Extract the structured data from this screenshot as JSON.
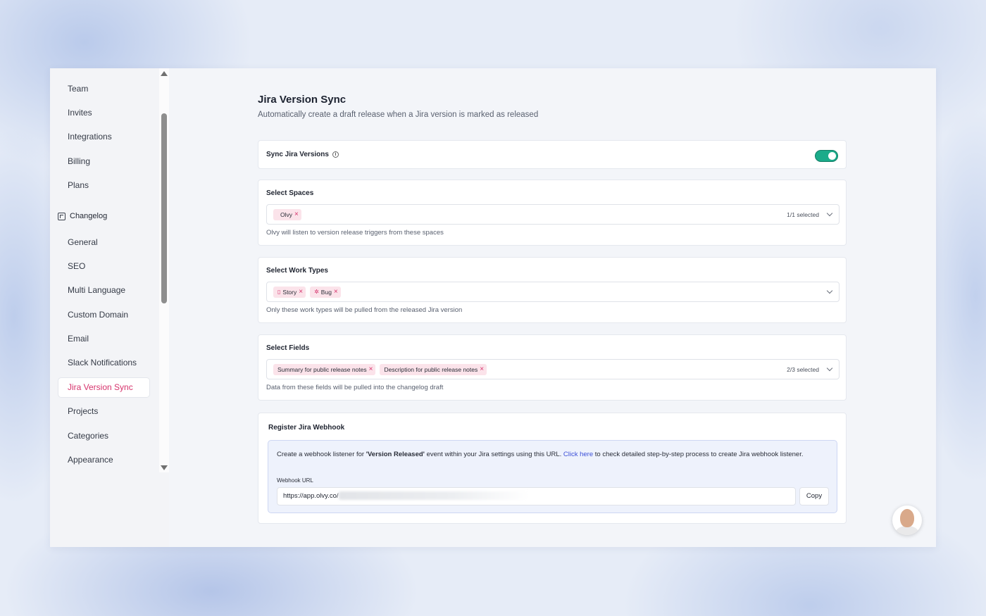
{
  "sidebar": {
    "items_top": [
      "Team",
      "Invites",
      "Integrations",
      "Billing",
      "Plans"
    ],
    "section_label": "Changelog",
    "items": [
      "General",
      "SEO",
      "Multi Language",
      "Custom Domain",
      "Email",
      "Slack Notifications",
      "Jira Version Sync",
      "Projects",
      "Categories",
      "Appearance"
    ],
    "active_item": "Jira Version Sync"
  },
  "page": {
    "title": "Jira Version Sync",
    "subtitle": "Automatically create a draft release when a Jira version is marked as released"
  },
  "sync": {
    "label": "Sync Jira Versions",
    "info_icon": "info-icon",
    "enabled": true,
    "toggle_color": "#1bab8a"
  },
  "spaces": {
    "label": "Select Spaces",
    "chips": [
      "Olvy"
    ],
    "count": "1/1 selected",
    "help": "Olvy will listen to version release triggers from these spaces"
  },
  "work_types": {
    "label": "Select Work Types",
    "chips": [
      {
        "label": "Story",
        "icon": "bookmark-icon"
      },
      {
        "label": "Bug",
        "icon": "bug-icon"
      }
    ],
    "help": "Only these work types will be pulled from the released Jira version"
  },
  "fields": {
    "label": "Select Fields",
    "chips": [
      "Summary for public release notes",
      "Description for public release notes"
    ],
    "count": "2/3 selected",
    "help": "Data from these fields will be pulled into the changelog draft"
  },
  "webhook": {
    "title": "Register Jira Webhook",
    "desc_before": "Create a webhook listener for ",
    "desc_bold": "'Version Released'",
    "desc_mid": " event within your Jira settings using this URL. ",
    "desc_link": "Click here",
    "desc_after": " to check detailed step-by-step process to create Jira webhook listener.",
    "url_label": "Webhook URL",
    "url_value": "https://app.olvy.co/",
    "copy_label": "Copy"
  },
  "colors": {
    "accent": "#d6336c",
    "chip_bg": "#fbe3ea",
    "link": "#3b4fd8"
  }
}
